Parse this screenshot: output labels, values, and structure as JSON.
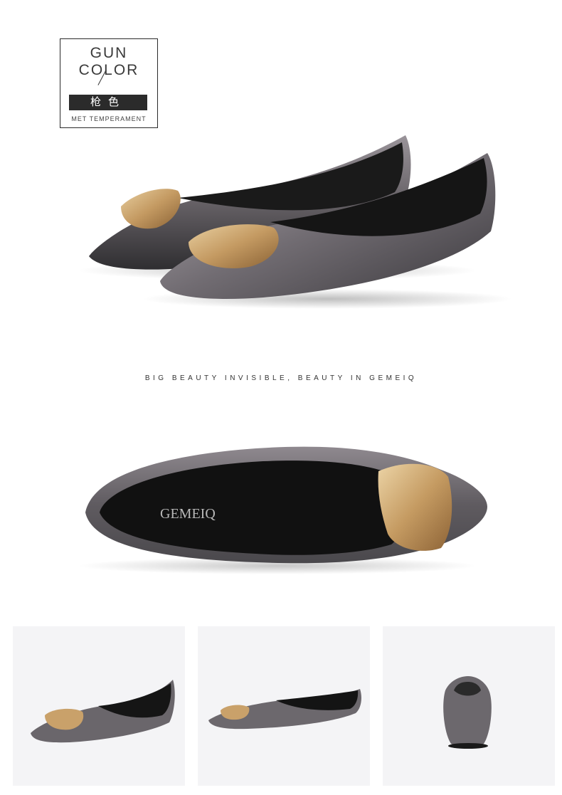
{
  "badge": {
    "title": "GUN COLOR",
    "chinese": "枪色",
    "subtitle": "MET TEMPERAMENT"
  },
  "tagline": "BIG BEAUTY INVISIBLE, BEAUTY IN GEMEIQ",
  "insole_brand": "GEMEIQ",
  "colors": {
    "gunmetal": "#6e6a6e",
    "gunmetal_dark": "#3b3a3d",
    "lining": "#141414",
    "buckle_gold": "#c9a16a",
    "thumb_bg": "#f4f4f6"
  },
  "thumbnails": [
    {
      "label": "side-angle-view"
    },
    {
      "label": "side-profile-view"
    },
    {
      "label": "rear-view"
    }
  ]
}
